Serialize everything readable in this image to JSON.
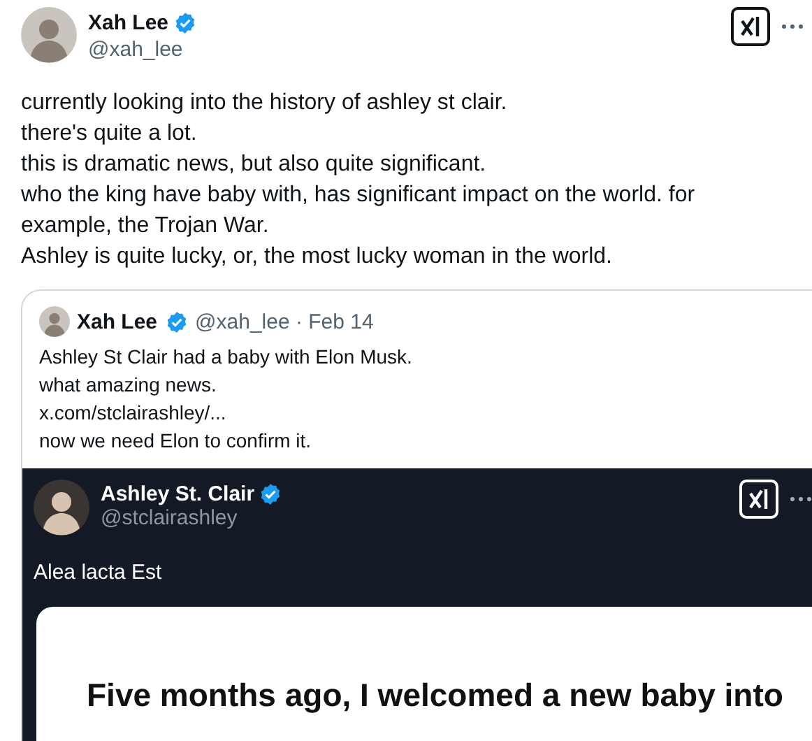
{
  "author": {
    "name": "Xah Lee",
    "verified": true,
    "handle": "@xah_lee"
  },
  "body": [
    "currently looking into the history of ashley st clair.",
    "there's quite a lot.",
    "this is dramatic news, but also quite significant.",
    "who the king have baby with, has significant impact on the world. for example, the Trojan War.",
    "Ashley is quite lucky, or, the most lucky woman in the world."
  ],
  "quoted": {
    "author": {
      "name": "Xah Lee",
      "verified": true,
      "meta": "@xah_lee · Feb 14"
    },
    "lines": [
      "Ashley St Clair had a baby with Elon Musk.",
      "what amazing news.",
      "x.com/stclairashley/...",
      "now we need Elon to confirm it."
    ],
    "embed": {
      "author": {
        "name": "Ashley St. Clair",
        "verified": true,
        "handle": "@stclairashley"
      },
      "text": "Alea lacta Est",
      "card_text": "Five months ago, I welcomed a new baby into"
    }
  }
}
